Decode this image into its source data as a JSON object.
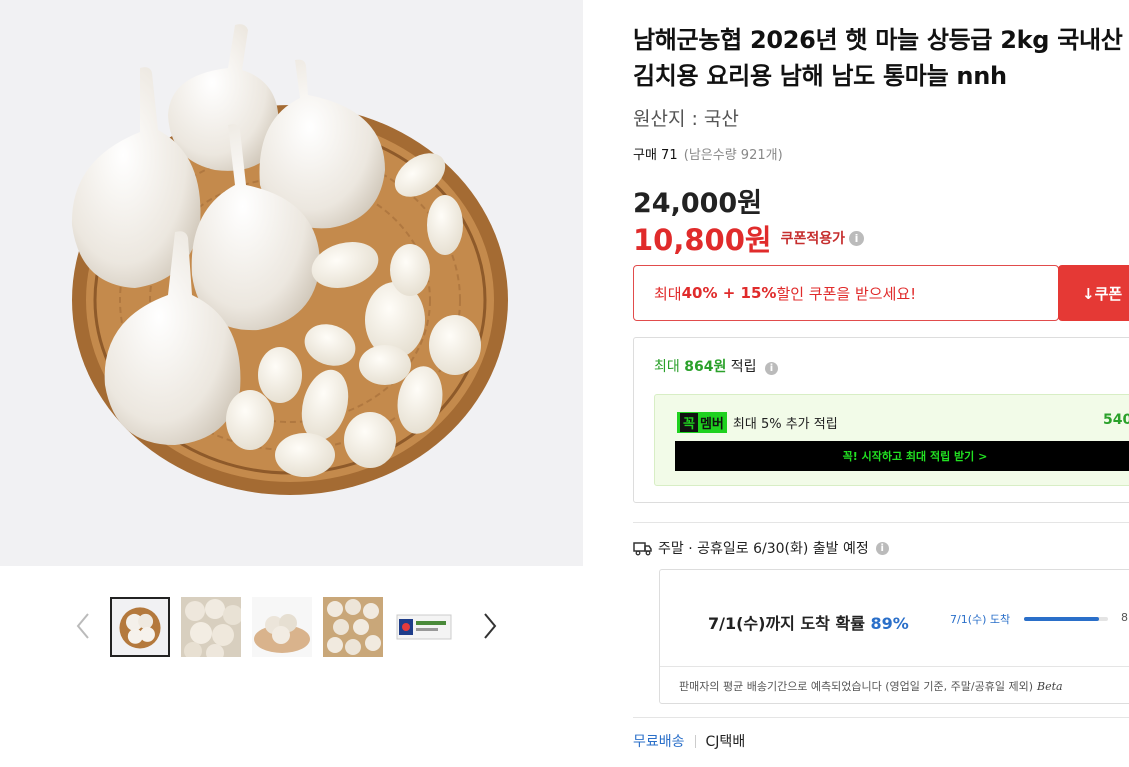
{
  "product": {
    "title": "남해군농협 2026년 햇 마늘 상등급 2kg 국내산 김치용 요리용 남해 남도 통마늘 nnh",
    "origin": "원산지 : 국산",
    "purchase_label": "구매 71",
    "remaining": "(남은수량 921개)"
  },
  "price": {
    "original": "24,000원",
    "sale": "10,800원",
    "sale_label": "쿠폰적용가"
  },
  "coupon": {
    "text_prefix": "최대 ",
    "text_bold": "40% + 15%",
    "text_suffix": " 할인 쿠폰을 받으세요!",
    "button_label": "↓쿠폰"
  },
  "points": {
    "prefix": "최대 ",
    "amount": "864원",
    "suffix": " 적립",
    "member_logo_k": "꼭",
    "member_logo_rest": "멤버",
    "member_text": "최대 5% 추가 적립",
    "member_amount": "540",
    "member_button": "꼭! 시작하고 최대 적립 받기 >"
  },
  "shipping": {
    "schedule": "주말 · 공휴일로 6/30(화) 출발 예정",
    "arrival_prefix": "7/1(수)까지 도착 확률 ",
    "arrival_pct": "89%",
    "bar_label": "7/1(수) 도착",
    "bar_fraction": 0.89,
    "bar_pct_text": "8",
    "note": "판매자의 평균 배송기간으로 예측되었습니다 (영업일 기준, 주말/공휴일 제외)",
    "beta": "Beta",
    "free_shipping": "무료배송",
    "carrier": "CJ택배"
  },
  "icons": {
    "gallery_prev": "chevron-left-icon",
    "gallery_next": "chevron-right-icon",
    "truck": "truck-icon",
    "info": "info-icon"
  },
  "colors": {
    "sale_red": "#e02b2b",
    "points_green": "#2ba12b",
    "link_blue": "#2a6fc9"
  }
}
